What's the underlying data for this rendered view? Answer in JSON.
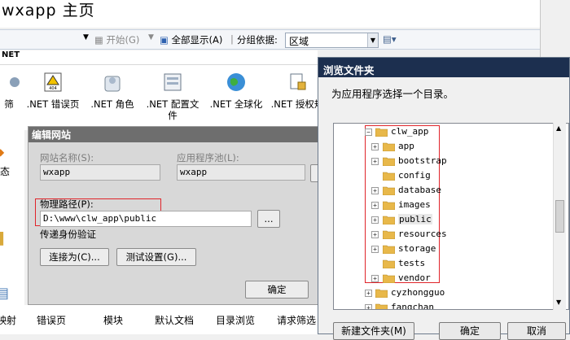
{
  "window": {
    "title": "wxapp 主页"
  },
  "toolbar": {
    "start_label": "开始(G)",
    "show_all_label": "全部显示(A)",
    "group_by_label": "分组依据:",
    "group_by_value": "区域"
  },
  "section": {
    "header": "NET"
  },
  "features": [
    {
      "label": "筛",
      "icon": "partial-icon"
    },
    {
      "label": ".NET 错误页",
      "icon": "error-page-icon"
    },
    {
      "label": ".NET 角色",
      "icon": "roles-icon"
    },
    {
      "label": ".NET 配置文件",
      "icon": "profile-icon"
    },
    {
      "label": ".NET 全球化",
      "icon": "globe-icon"
    },
    {
      "label": ".NET 授权规",
      "icon": "authorization-icon"
    }
  ],
  "left_strip": {
    "label": "态"
  },
  "bottom_features": [
    "映射",
    "错误页",
    "模块",
    "默认文档",
    "目录浏览",
    "请求筛选"
  ],
  "edit_site": {
    "title": "编辑网站",
    "site_name_label": "网站名称(S):",
    "site_name_value": "wxapp",
    "app_pool_label": "应用程序池(L):",
    "app_pool_value": "wxapp",
    "physical_path_label": "物理路径(P):",
    "physical_path_value": "D:\\www\\clw_app\\public",
    "browse_button": "...",
    "pass_through_label": "传递身份验证",
    "connect_as_button": "连接为(C)...",
    "test_settings_button": "测试设置(G)...",
    "ok_button": "确定"
  },
  "browse": {
    "title": "浏览文件夹",
    "description": "为应用程序选择一个目录。",
    "tree": [
      {
        "label": "clw_app",
        "expanded": true,
        "level": 0
      },
      {
        "label": "app",
        "level": 1
      },
      {
        "label": "bootstrap",
        "level": 1
      },
      {
        "label": "config",
        "level": 1
      },
      {
        "label": "database",
        "level": 1
      },
      {
        "label": "images",
        "level": 1
      },
      {
        "label": "public",
        "level": 1,
        "selected": true
      },
      {
        "label": "resources",
        "level": 1
      },
      {
        "label": "storage",
        "level": 1
      },
      {
        "label": "tests",
        "level": 1
      },
      {
        "label": "vendor",
        "level": 1
      },
      {
        "label": "cyzhongguo",
        "level": 0
      },
      {
        "label": "fangchan",
        "level": 0
      }
    ],
    "new_folder_button": "新建文件夹(M)",
    "ok_button": "确定",
    "cancel_button": "取消"
  },
  "colors": {
    "highlight_box": "#e0242a",
    "dialog_title": "#1c2f4f",
    "folder": "#e8b84a"
  }
}
